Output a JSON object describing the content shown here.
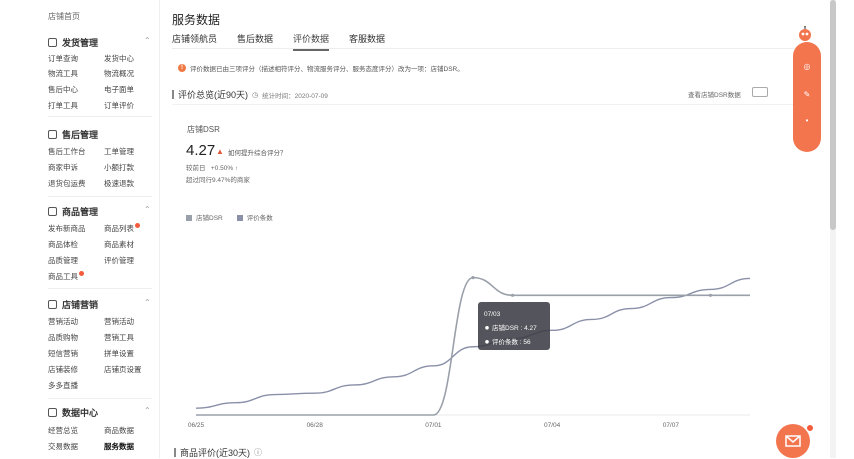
{
  "sidebar": {
    "home": "店铺首页",
    "sections": [
      {
        "title": "发货管理",
        "items": [
          "订单查询",
          "发货中心",
          "物流工具",
          "物流概况",
          "售后中心",
          "电子面单",
          "打单工具",
          "订单评价"
        ]
      },
      {
        "title": "商品管理",
        "items": [
          "发布新商品",
          "商品列表",
          "商品体检",
          "商品素材",
          "品质管理",
          "评价管理",
          "商品工具"
        ]
      },
      {
        "title": "店铺营销",
        "items": [
          "营销活动",
          "营销活动",
          "品质购物",
          "营销工具",
          "短信营销",
          "拼单设置",
          "店铺装修",
          "店铺页设置",
          "多多直播"
        ]
      },
      {
        "title": "数据中心",
        "items": [
          "经营总览",
          "商品数据",
          "交易数据",
          "服务数据"
        ]
      }
    ],
    "section2": {
      "title": "售后管理",
      "items": [
        "售后工作台",
        "工单管理",
        "商家申诉",
        "小额打款",
        "退货包运费",
        "极速退款"
      ]
    }
  },
  "main": {
    "page_title": "服务数据",
    "tabs": [
      "店铺领航员",
      "售后数据",
      "评价数据",
      "客服数据"
    ],
    "active_tab": 2,
    "notice": "评价数据已由三项评分（描述相符评分、物流服务评分、服务态度评分）改为一项：店铺DSR。",
    "dsr_title": "评价总览(近90天)",
    "dsr_meta": "统计时间：2020-07-09",
    "toggle_label": "查看店铺DSR数据",
    "store_dsr_label": "店铺DSR",
    "score": "4.27",
    "score_tip": "如何提升综合评分？",
    "delta_label": "较前日",
    "delta_value": "+0.50%",
    "beat_text": "超过同行9.47%的商家",
    "legend": [
      "店铺DSR",
      "评价条数"
    ],
    "bottom_title": "商品评价(近30天)",
    "tooltip": {
      "date": "07/03",
      "row1_label": "店铺DSR",
      "row1_value": "4.27",
      "row2_label": "评价条数",
      "row2_value": "56"
    }
  },
  "chart_data": {
    "type": "line",
    "x": [
      "06/25",
      "06/26",
      "06/27",
      "06/28",
      "06/29",
      "06/30",
      "07/01",
      "07/02",
      "07/03",
      "07/04",
      "07/05",
      "07/06",
      "07/07",
      "07/08",
      "07/09"
    ],
    "x_ticks": [
      "06/25",
      "06/28",
      "07/01",
      "07/04",
      "07/07"
    ],
    "series": [
      {
        "name": "店铺DSR",
        "color": "#9aa0aa",
        "values": [
          0,
          0,
          0,
          0,
          0,
          0,
          0,
          4.9,
          4.27,
          4.27,
          4.27,
          4.27,
          4.27,
          4.27,
          4.27
        ]
      },
      {
        "name": "评价条数",
        "color": "#8a90a8",
        "values": [
          5,
          9,
          15,
          16,
          22,
          28,
          36,
          50,
          56,
          62,
          70,
          78,
          86,
          92,
          100
        ]
      }
    ]
  },
  "colors": {
    "accent": "#f3754e",
    "badge": "#f45b3a"
  }
}
